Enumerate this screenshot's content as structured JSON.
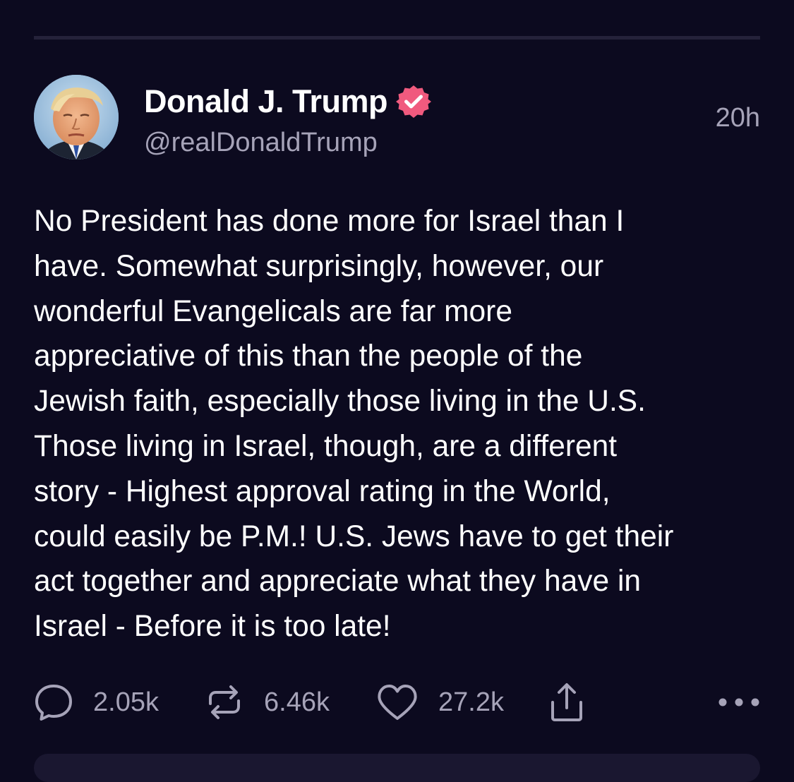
{
  "post": {
    "author": {
      "name": "Donald J. Trump",
      "handle": "@realDonaldTrump",
      "verified": true,
      "verified_color": "#f05a7e"
    },
    "timestamp": "20h",
    "text": "No President has done more for Israel than I\nhave. Somewhat surprisingly, however, our\nwonderful Evangelicals are far more\nappreciative of this than the people of the\nJewish faith, especially those living in the U.S.\nThose living in Israel, though, are a different\nstory - Highest approval rating in the World,\ncould easily be P.M.! U.S. Jews have to get their\nact together and appreciate what they have in\nIsrael - Before it is too late!",
    "stats": {
      "replies": "2.05k",
      "reposts": "6.46k",
      "likes": "27.2k"
    }
  },
  "icons": {
    "reply": "reply-icon",
    "repost": "repost-icon",
    "like": "heart-icon",
    "share": "share-icon",
    "more": "more-options-icon"
  },
  "colors": {
    "background": "#0c0a1f",
    "text": "#ffffff",
    "secondary_text": "#a6a3b8",
    "divider": "#25223a"
  }
}
